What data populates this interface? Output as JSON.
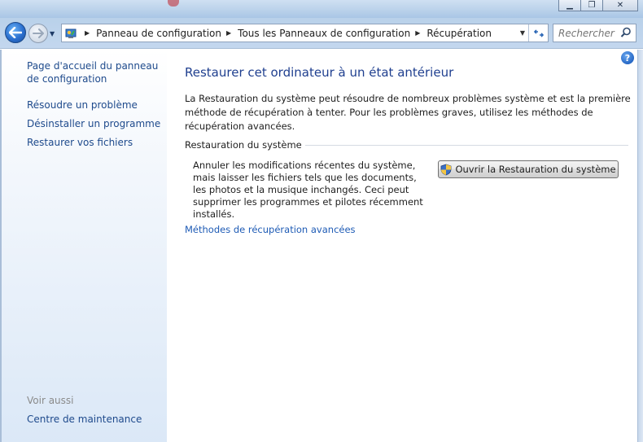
{
  "window": {
    "minimize_icon": "minimize-icon",
    "maximize_icon": "maximize-icon",
    "close_icon": "close-icon"
  },
  "address_bar": {
    "crumbs": [
      {
        "label": "Panneau de configuration"
      },
      {
        "label": "Tous les Panneaux de configuration"
      },
      {
        "label": "Récupération"
      }
    ]
  },
  "search": {
    "placeholder": "Rechercher"
  },
  "sidebar": {
    "links": [
      {
        "label": "Page d'accueil du panneau de configuration"
      },
      {
        "label": "Résoudre un problème"
      },
      {
        "label": "Désinstaller un programme"
      },
      {
        "label": "Restaurer vos fichiers"
      }
    ],
    "see_also_header": "Voir aussi",
    "see_also_links": [
      {
        "label": "Centre de maintenance"
      }
    ]
  },
  "main": {
    "title": "Restaurer cet ordinateur à un état antérieur",
    "intro": "La Restauration du système peut résoudre de nombreux problèmes système et est la première méthode de récupération à tenter. Pour les problèmes graves, utilisez les méthodes de récupération avancées.",
    "group_title": "Restauration du système",
    "group_description": "Annuler les modifications récentes du système, mais laisser les fichiers tels que les documents, les photos et la musique inchangés. Ceci peut supprimer les programmes et pilotes récemment installés.",
    "restore_button_label": "Ouvrir la Restauration du système",
    "advanced_link": "Méthodes de récupération avancées"
  },
  "colors": {
    "title_blue": "#1f3f8f",
    "link_blue": "#1e4a8c",
    "accent_link": "#1e5bb5",
    "nav_bar": "#c3d7ee"
  }
}
